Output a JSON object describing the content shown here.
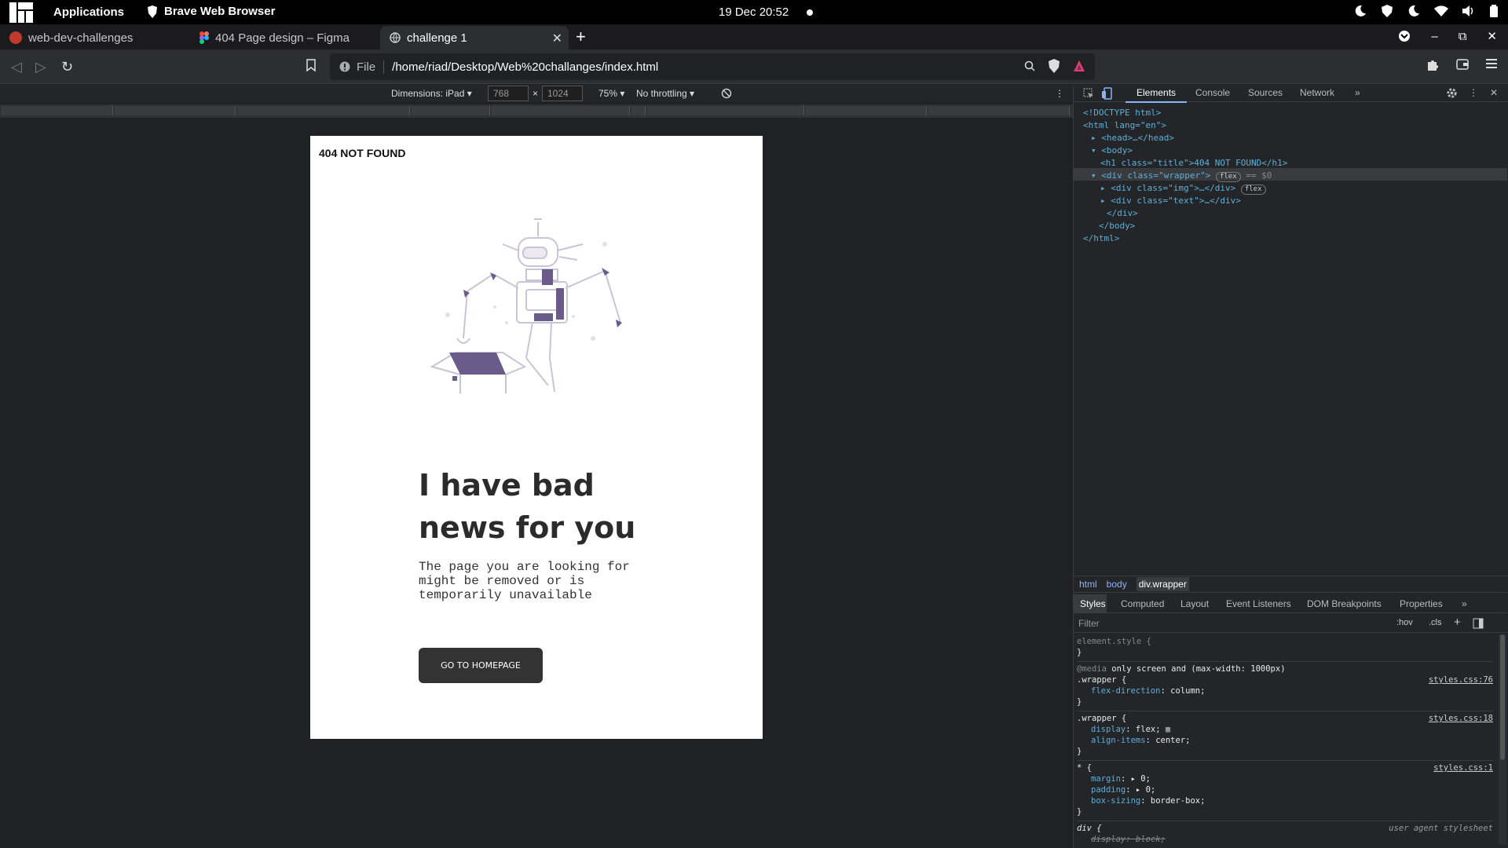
{
  "system_bar": {
    "apps_label": "Applications",
    "app_name": "Brave Web Browser",
    "clock": "19 Dec  20:52"
  },
  "tabs": [
    {
      "label": "web-dev-challenges"
    },
    {
      "label": "404 Page design – Figma"
    },
    {
      "label": "challenge 1"
    }
  ],
  "address_bar": {
    "scheme_label": "File",
    "url": "/home/riad/Desktop/Web%20challanges/index.html"
  },
  "device_toolbar": {
    "dimensions": "Dimensions: iPad",
    "width": "768",
    "times": "×",
    "height": "1024",
    "zoom": "75%",
    "throttle": "No throttling"
  },
  "page": {
    "title": "404 NOT FOUND",
    "headline": "I have bad news for you",
    "description": "The page you are looking for might be removed or is temporarily unavailable",
    "button_label": "GO TO HOMEPAGE"
  },
  "devtools": {
    "tabs": [
      "Elements",
      "Console",
      "Sources",
      "Network"
    ],
    "dom": {
      "doctype": "<!DOCTYPE html>",
      "html_open": "<html lang=\"en\">",
      "head": "<head>…</head>",
      "body_open": "<body>",
      "h1": "<h1 class=\"title\">404 NOT FOUND</h1>",
      "wrapper": "<div class=\"wrapper\">",
      "wrapper_badge": "flex",
      "wrapper_suffix": "== $0",
      "img": "<div class=\"img\">…</div>",
      "img_badge": "flex",
      "text": "<div class=\"text\">…</div>",
      "div_close": "</div>",
      "body_close": "</body>",
      "html_close": "</html>"
    },
    "breadcrumb": [
      "html",
      "body",
      "div.wrapper"
    ],
    "style_tabs": [
      "Styles",
      "Computed",
      "Layout",
      "Event Listeners",
      "DOM Breakpoints",
      "Properties"
    ],
    "filter_placeholder": "Filter",
    "hov": ":hov",
    "cls": ".cls",
    "rules": {
      "element_style": "element.style {",
      "close": "}",
      "media_keyword": "@media",
      "media_query": "only screen and (max-width: 1000px)",
      "wrapper_sel": ".wrapper {",
      "r1_src": "styles.css:76",
      "r1_prop": "flex-direction",
      "r1_val": "column;",
      "r2_src": "styles.css:18",
      "r2_p1": "display",
      "r2_v1": "flex;",
      "r2_p2": "align-items",
      "r2_v2": "center;",
      "star_sel": "* {",
      "r3_src": "styles.css:1",
      "r3_p1": "margin",
      "r3_v1": "0;",
      "r3_p2": "padding",
      "r3_v2": "0;",
      "r3_p3": "box-sizing",
      "r3_v3": "border-box;",
      "div_sel": "div {",
      "ua_src": "user agent stylesheet",
      "r4_p1": "display: block;"
    }
  },
  "colors": {
    "robot_accent": "#6b5b8a",
    "link_blue": "#8ab4f8"
  }
}
